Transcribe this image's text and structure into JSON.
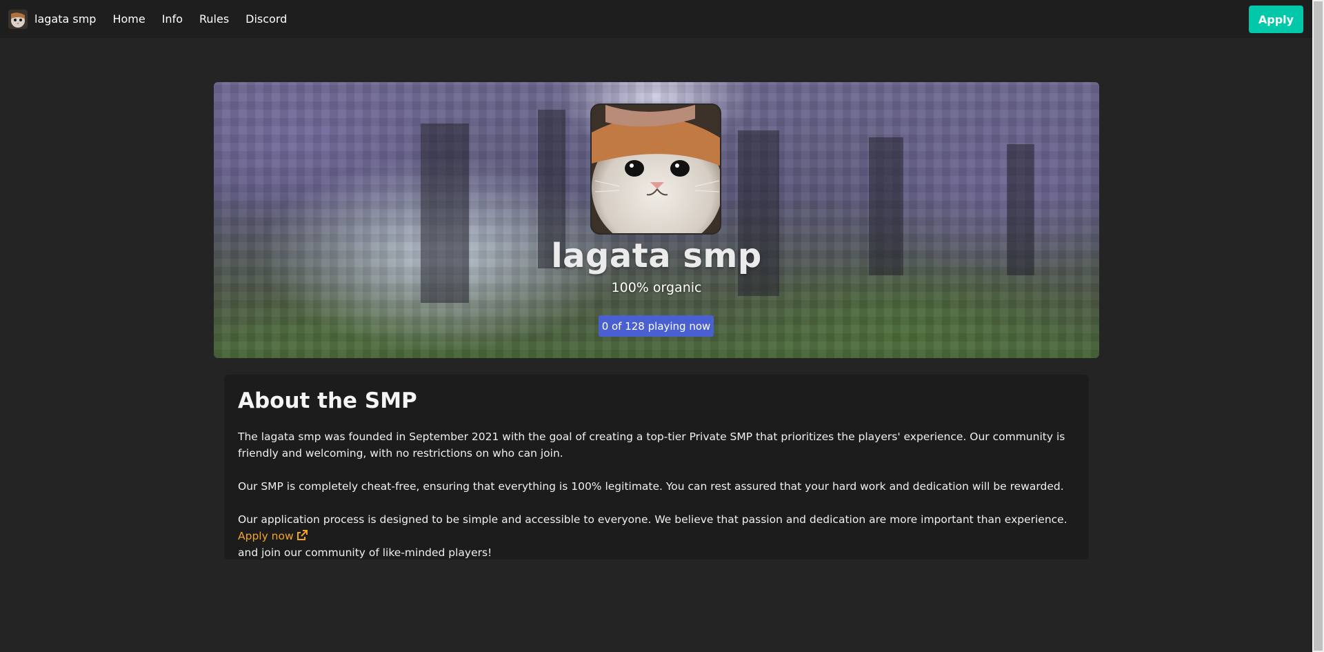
{
  "navbar": {
    "brand": "lagata smp",
    "links": [
      {
        "label": "Home"
      },
      {
        "label": "Info"
      },
      {
        "label": "Rules"
      },
      {
        "label": "Discord"
      }
    ],
    "apply_label": "Apply",
    "apply_color": "#00c8a8"
  },
  "hero": {
    "title": "lagata smp",
    "subtitle": "100% organic",
    "status": "0 of 128 playing now",
    "status_color": "#4a5fd0"
  },
  "about": {
    "title": "About the SMP",
    "paragraph1": "The lagata smp was founded in September 2021 with the goal of creating a top-tier Private SMP that prioritizes the players' experience. Our community is friendly and welcoming, with no restrictions on who can join.",
    "paragraph2": "Our SMP is completely cheat-free, ensuring that everything is 100% legitimate. You can rest assured that your hard work and dedication will be rewarded.",
    "paragraph3_pre": "Our application process is designed to be simple and accessible to everyone. We believe that passion and dedication are more important than experience. ",
    "apply_link": "Apply now",
    "paragraph3_post": "and join our community of like-minded players!",
    "link_color": "#f5a524",
    "link_icon": "external-link-icon"
  }
}
